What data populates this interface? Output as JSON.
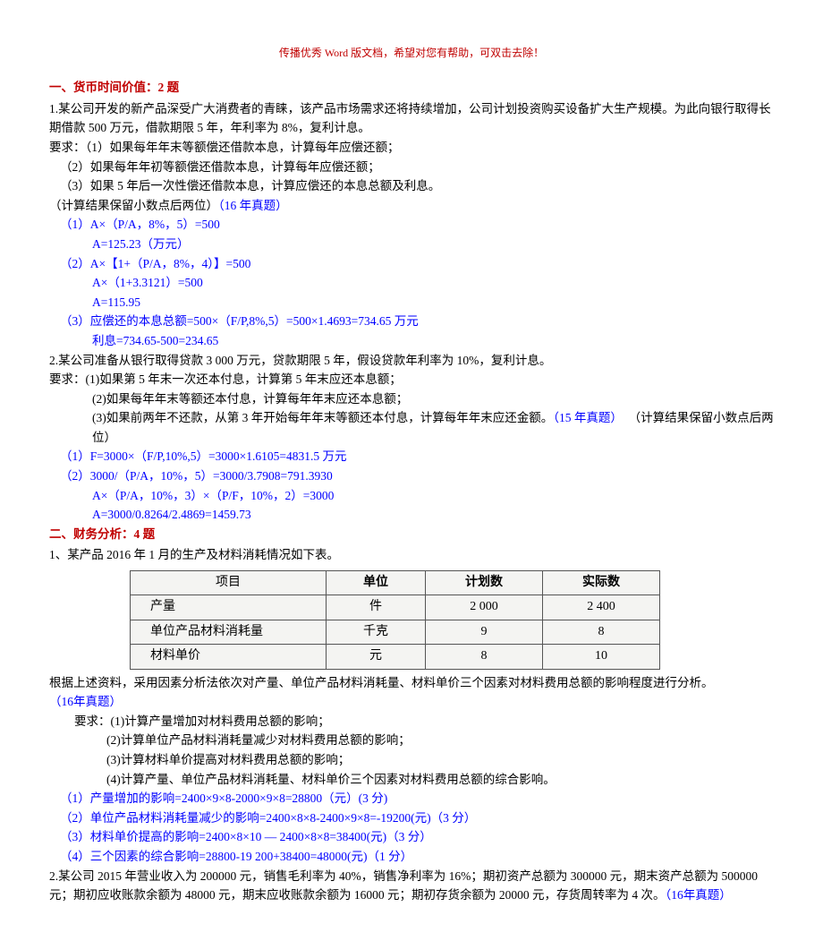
{
  "header_note": "传播优秀 Word 版文档，希望对您有帮助，可双击去除！",
  "section1": {
    "title": "一、货币时间价值：2 题",
    "q1": {
      "p1": "1.某公司开发的新产品深受广大消费者的青睐，该产品市场需求还将持续增加，公司计划投资购买设备扩大生产规模。为此向银行取得长期借款 500 万元，借款期限 5 年，年利率为 8%，复利计息。",
      "p2": "要求：（1）如果每年年末等额偿还借款本息，计算每年应偿还额；",
      "p3": "（2）如果每年年初等额偿还借款本息，计算每年应偿还额；",
      "p4": "（3）如果 5 年后一次性偿还借款本息，计算应偿还的本息总额及利息。",
      "p5": "（计算结果保留小数点后两位）",
      "p5b": "（16 年真题）",
      "a1": "（1）A×（P/A，8%，5）=500",
      "a1b": "A=125.23（万元）",
      "a2": "（2）A×【1+（P/A，8%，4）】=500",
      "a2b": "A×（1+3.3121）=500",
      "a2c": "A=115.95",
      "a3": "（3）应偿还的本息总额=500×（F/P,8%,5）=500×1.4693=734.65 万元",
      "a3b": "利息=734.65-500=234.65"
    },
    "q2": {
      "p1": "2.某公司准备从银行取得贷款 3 000 万元，贷款期限 5 年，假设贷款年利率为 10%，复利计息。",
      "p2": "要求：(1)如果第 5 年末一次还本付息，计算第 5 年末应还本息额；",
      "p3": "(2)如果每年年末等额还本付息，计算每年年末应还本息额；",
      "p4a": "(3)如果前两年不还款，从第 3 年开始每年年末等额还本付息，计算每年年末应还金额。",
      "p4b": "（15 年真题）",
      "p4c": "（计算结果保留小数点后两位）",
      "a1": "（1）F=3000×（F/P,10%,5）=3000×1.6105=4831.5 万元",
      "a2": "（2）3000/（P/A，10%，5）=3000/3.7908=791.3930",
      "a2b": "A×（P/A，10%，3）×（P/F，10%，2）=3000",
      "a2c": "A=3000/0.8264/2.4869=1459.73"
    }
  },
  "section2": {
    "title": "二、财务分析：4 题",
    "q1": {
      "p1": "1、某产品 2016 年 1 月的生产及材料消耗情况如下表。",
      "table": {
        "headers": [
          "项目",
          "单位",
          "计划数",
          "实际数"
        ],
        "rows": [
          {
            "name": "产量",
            "unit": "件",
            "plan": "2 000",
            "actual": "2 400"
          },
          {
            "name": "单位产品材料消耗量",
            "unit": "千克",
            "plan": "9",
            "actual": "8"
          },
          {
            "name": "材料单价",
            "unit": "元",
            "plan": "8",
            "actual": "10"
          }
        ]
      },
      "p2a": "根据上述资料，采用因素分析法依次对产量、单位产品材料消耗量、材料单价三个因素对材料费用总额的影响程度进行分析。",
      "p2b": "（16年真题）",
      "r1": "要求：(1)计算产量增加对材料费用总额的影响；",
      "r2": "(2)计算单位产品材料消耗量减少对材料费用总额的影响；",
      "r3": "(3)计算材料单价提高对材料费用总额的影响；",
      "r4": "(4)计算产量、单位产品材料消耗量、材料单价三个因素对材料费用总额的综合影响。",
      "a1": "（1）产量增加的影响=2400×9×8-2000×9×8=28800（元）(3 分)",
      "a2": "（2）单位产品材料消耗量减少的影响=2400×8×8-2400×9×8=-19200(元)（3 分）",
      "a3": "（3）材料单价提高的影响=2400×8×10 — 2400×8×8=38400(元)（3 分）",
      "a4": "（4）三个因素的综合影响=28800-19 200+38400=48000(元)（1 分）"
    },
    "q2": {
      "p1": "2.某公司 2015 年营业收入为 200000 元，销售毛利率为 40%，销售净利率为 16%；期初资产总额为 300000 元，期末资产总额为 500000 元；期初应收账款余额为 48000 元，期末应收账款余额为 16000 元；期初存货余额为 20000 元，存货周转率为 4 次。",
      "p1b": "（16年真题）"
    }
  },
  "chart_data": {
    "type": "table",
    "title": "某产品2016年1月生产及材料消耗情况",
    "columns": [
      "项目",
      "单位",
      "计划数",
      "实际数"
    ],
    "rows": [
      [
        "产量",
        "件",
        2000,
        2400
      ],
      [
        "单位产品材料消耗量",
        "千克",
        9,
        8
      ],
      [
        "材料单价",
        "元",
        8,
        10
      ]
    ]
  }
}
